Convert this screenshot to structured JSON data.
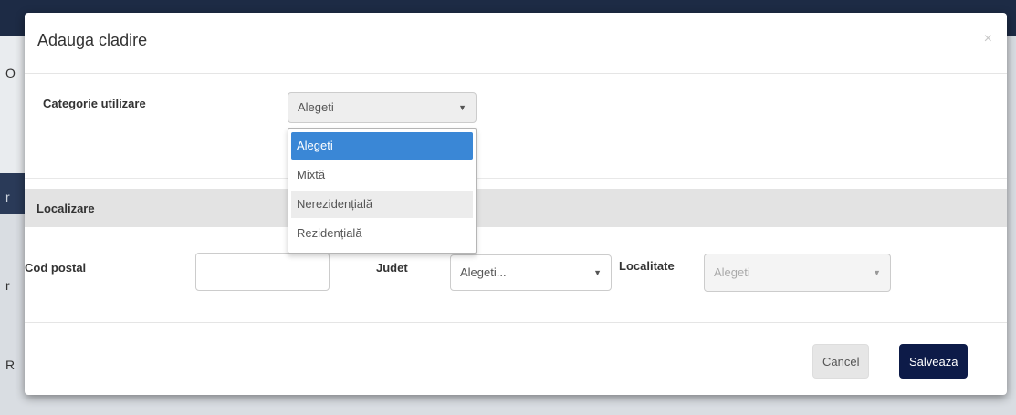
{
  "background": {
    "edge_letters": [
      "O",
      "r",
      "r",
      "R"
    ]
  },
  "modal": {
    "title": "Adauga cladire",
    "close_symbol": "×",
    "category": {
      "label": "Categorie utilizare",
      "selected": "Alegeti",
      "options": [
        "Alegeti",
        "Mixtă",
        "Nerezidențială",
        "Rezidențială"
      ],
      "highlighted_option": "Alegeti",
      "hovered_option": "Nerezidențială"
    },
    "location_section": {
      "label": "Localizare"
    },
    "postal_code": {
      "label": "Cod postal",
      "value": ""
    },
    "county": {
      "label": "Judet",
      "selected": "Alegeti..."
    },
    "locality": {
      "label": "Localitate",
      "selected": "Alegeti",
      "disabled": true
    },
    "footer": {
      "cancel_label": "Cancel",
      "save_label": "Salveaza"
    }
  },
  "colors": {
    "primary_button": "#0d1b48",
    "selected_option": "#3a87d6",
    "section_band": "#e3e3e3"
  }
}
